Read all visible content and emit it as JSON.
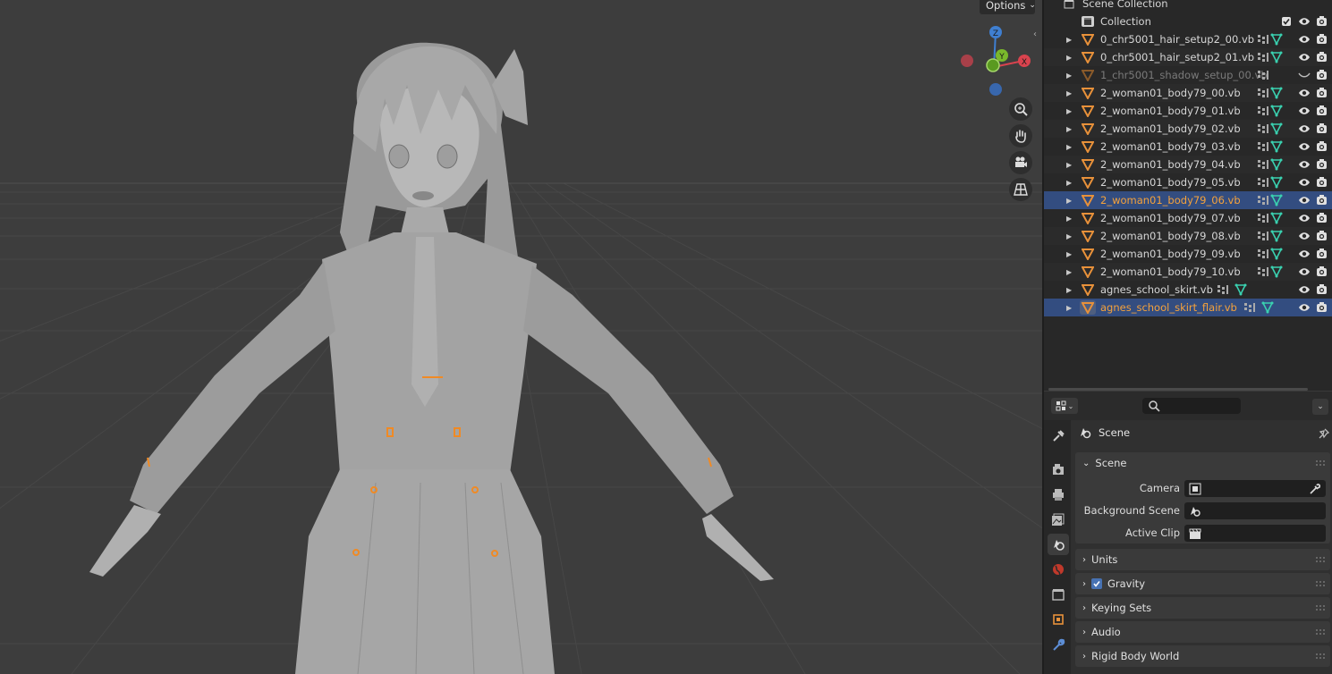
{
  "viewport": {
    "options_label": "Options",
    "gizmo": {
      "x": "X",
      "y": "Y",
      "z": "Z"
    }
  },
  "outliner": {
    "root": "Scene Collection",
    "collection": "Collection",
    "objects": [
      {
        "name": "0_chr5001_hair_setup2_00.vb",
        "state": "normal"
      },
      {
        "name": "0_chr5001_hair_setup2_01.vb",
        "state": "normal"
      },
      {
        "name": "1_chr5001_shadow_setup_00.vb",
        "state": "hidden"
      },
      {
        "name": "2_woman01_body79_00.vb",
        "state": "normal"
      },
      {
        "name": "2_woman01_body79_01.vb",
        "state": "normal"
      },
      {
        "name": "2_woman01_body79_02.vb",
        "state": "normal"
      },
      {
        "name": "2_woman01_body79_03.vb",
        "state": "normal"
      },
      {
        "name": "2_woman01_body79_04.vb",
        "state": "normal"
      },
      {
        "name": "2_woman01_body79_05.vb",
        "state": "normal"
      },
      {
        "name": "2_woman01_body79_06.vb",
        "state": "selected"
      },
      {
        "name": "2_woman01_body79_07.vb",
        "state": "normal"
      },
      {
        "name": "2_woman01_body79_08.vb",
        "state": "normal"
      },
      {
        "name": "2_woman01_body79_09.vb",
        "state": "normal"
      },
      {
        "name": "2_woman01_body79_10.vb",
        "state": "normal"
      },
      {
        "name": "agnes_school_skirt.vb",
        "state": "normal"
      },
      {
        "name": "agnes_school_skirt_flair.vb",
        "state": "active"
      }
    ]
  },
  "properties": {
    "context_title": "Scene",
    "scene_panel": {
      "title": "Scene",
      "camera_label": "Camera",
      "background_scene_label": "Background Scene",
      "active_clip_label": "Active Clip"
    },
    "panels": {
      "units": "Units",
      "gravity": "Gravity",
      "keying_sets": "Keying Sets",
      "audio": "Audio",
      "rigid_body_world": "Rigid Body World"
    }
  },
  "colors": {
    "selected_text": "#f5a23b",
    "selected_row": "#334d80",
    "active_row": "#4b63a0",
    "mesh_icon": "#e8913a",
    "data_icon": "#3ad1b0"
  }
}
